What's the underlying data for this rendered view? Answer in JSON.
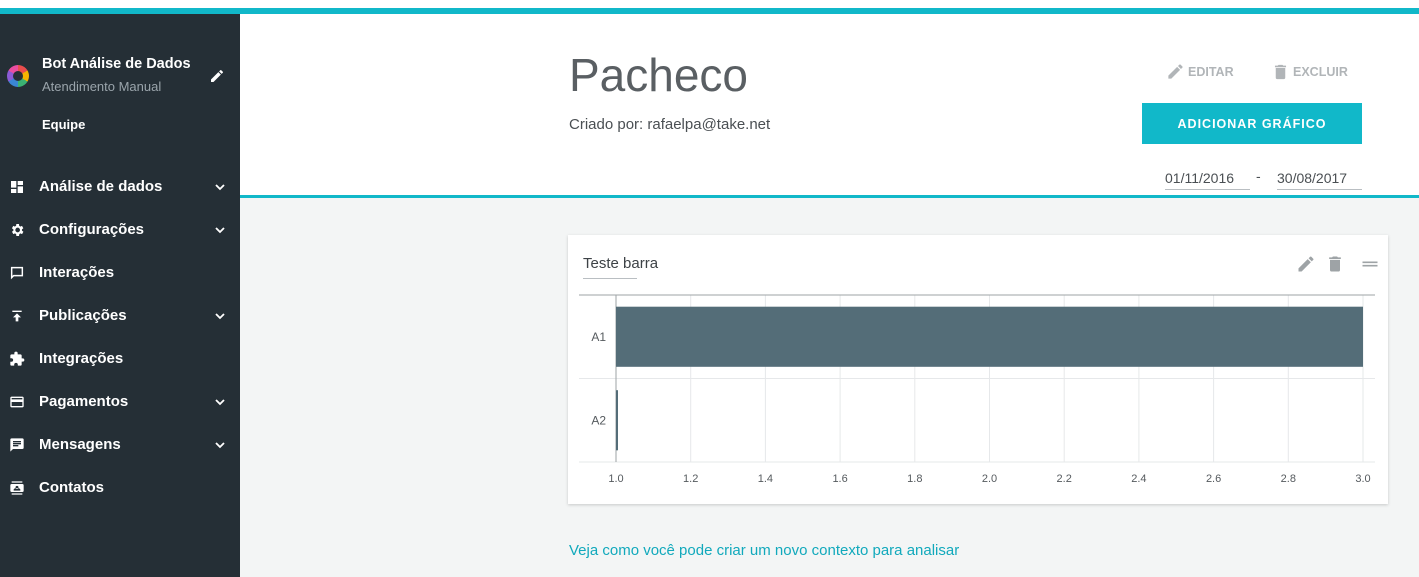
{
  "colors": {
    "accent": "#11b8c9",
    "sidebar_bg": "#252f36",
    "bar": "#546d78"
  },
  "sidebar": {
    "bot_name": "Bot Análise de Dados",
    "bot_subtitle": "Atendimento Manual",
    "team_label": "Equipe",
    "items": [
      {
        "label": "Análise de dados",
        "icon": "dashboard-icon",
        "has_submenu": true
      },
      {
        "label": "Configurações",
        "icon": "gear-icon",
        "has_submenu": true
      },
      {
        "label": "Interações",
        "icon": "chat-icon",
        "has_submenu": false
      },
      {
        "label": "Publicações",
        "icon": "publish-icon",
        "has_submenu": true
      },
      {
        "label": "Integrações",
        "icon": "puzzle-icon",
        "has_submenu": false
      },
      {
        "label": "Pagamentos",
        "icon": "credit-card-icon",
        "has_submenu": true
      },
      {
        "label": "Mensagens",
        "icon": "message-icon",
        "has_submenu": true
      },
      {
        "label": "Contatos",
        "icon": "contacts-icon",
        "has_submenu": false
      }
    ]
  },
  "header": {
    "title": "Pacheco",
    "created_by": "Criado por: rafaelpa@take.net",
    "edit_label": "EDITAR",
    "delete_label": "EXCLUIR",
    "add_chart_label": "ADICIONAR GRÁFICO",
    "date_from": "01/11/2016",
    "date_separator": "-",
    "date_to": "30/08/2017"
  },
  "card": {
    "title": "Teste barra"
  },
  "chart_data": {
    "type": "bar",
    "orientation": "horizontal",
    "title": "Teste barra",
    "categories": [
      "A1",
      "A2"
    ],
    "values": [
      3.0,
      1.0
    ],
    "xlim": [
      1.0,
      3.0
    ],
    "xticks": [
      "1.0",
      "1.2",
      "1.4",
      "1.6",
      "1.8",
      "2.0",
      "2.2",
      "2.4",
      "2.6",
      "2.8",
      "3.0"
    ],
    "grid": true
  },
  "footer": {
    "help_link": "Veja como você pode criar um novo contexto para analisar"
  }
}
